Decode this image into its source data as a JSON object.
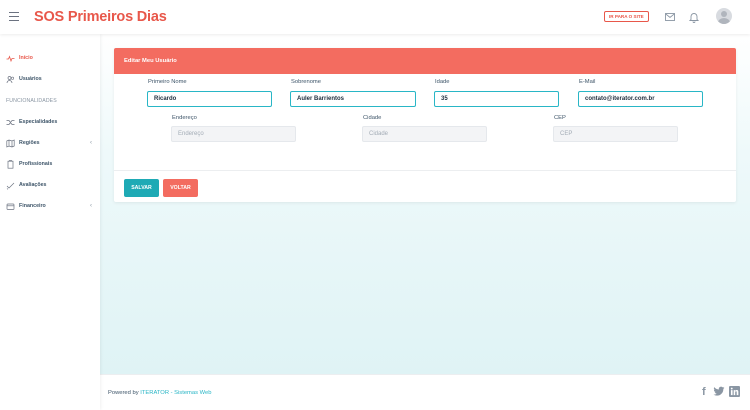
{
  "header": {
    "brand": "SOS Primeiros Dias",
    "site_button": "IR PARA O SITE",
    "icons": [
      "menu-icon",
      "mail-icon",
      "bell-icon",
      "user-avatar"
    ]
  },
  "sidebar": {
    "items": [
      {
        "label": "Início",
        "icon": "activity-icon",
        "active": true
      },
      {
        "label": "Usuários",
        "icon": "users-icon"
      }
    ],
    "section_label": "FUNCIONALIDADES",
    "features": [
      {
        "label": "Especialidades",
        "icon": "shuffle-icon"
      },
      {
        "label": "Regiões",
        "icon": "map-icon",
        "has_children": true
      },
      {
        "label": "Profissionais",
        "icon": "clipboard-icon"
      },
      {
        "label": "Avaliações",
        "icon": "check-icon"
      },
      {
        "label": "Financeiro",
        "icon": "wallet-icon",
        "has_children": true
      }
    ],
    "chevron": "‹"
  },
  "form": {
    "title": "Editar Meu Usuário",
    "fields": {
      "first_name": {
        "label": "Primeiro Nome",
        "value": "Ricardo"
      },
      "last_name": {
        "label": "Sobrenome",
        "value": "Auler Barrientos"
      },
      "age": {
        "label": "Idade",
        "value": "35"
      },
      "email": {
        "label": "E-Mail",
        "value": "contato@iterator.com.br"
      },
      "address": {
        "label": "Endereço",
        "placeholder": "Endereço"
      },
      "city": {
        "label": "Cidade",
        "placeholder": "Cidade"
      },
      "zip": {
        "label": "CEP",
        "placeholder": "CEP"
      }
    },
    "buttons": {
      "save": "SALVAR",
      "back": "VOLTAR"
    }
  },
  "footer": {
    "prefix": "Powered by ",
    "company": "ITERATOR - Sistemas Web",
    "social": [
      "facebook-icon",
      "twitter-icon",
      "linkedin-icon"
    ]
  },
  "colors": {
    "brand": "#e8574a",
    "card_header": "#f36c60",
    "accent": "#29b6c6",
    "save_button": "#1eaab5"
  }
}
